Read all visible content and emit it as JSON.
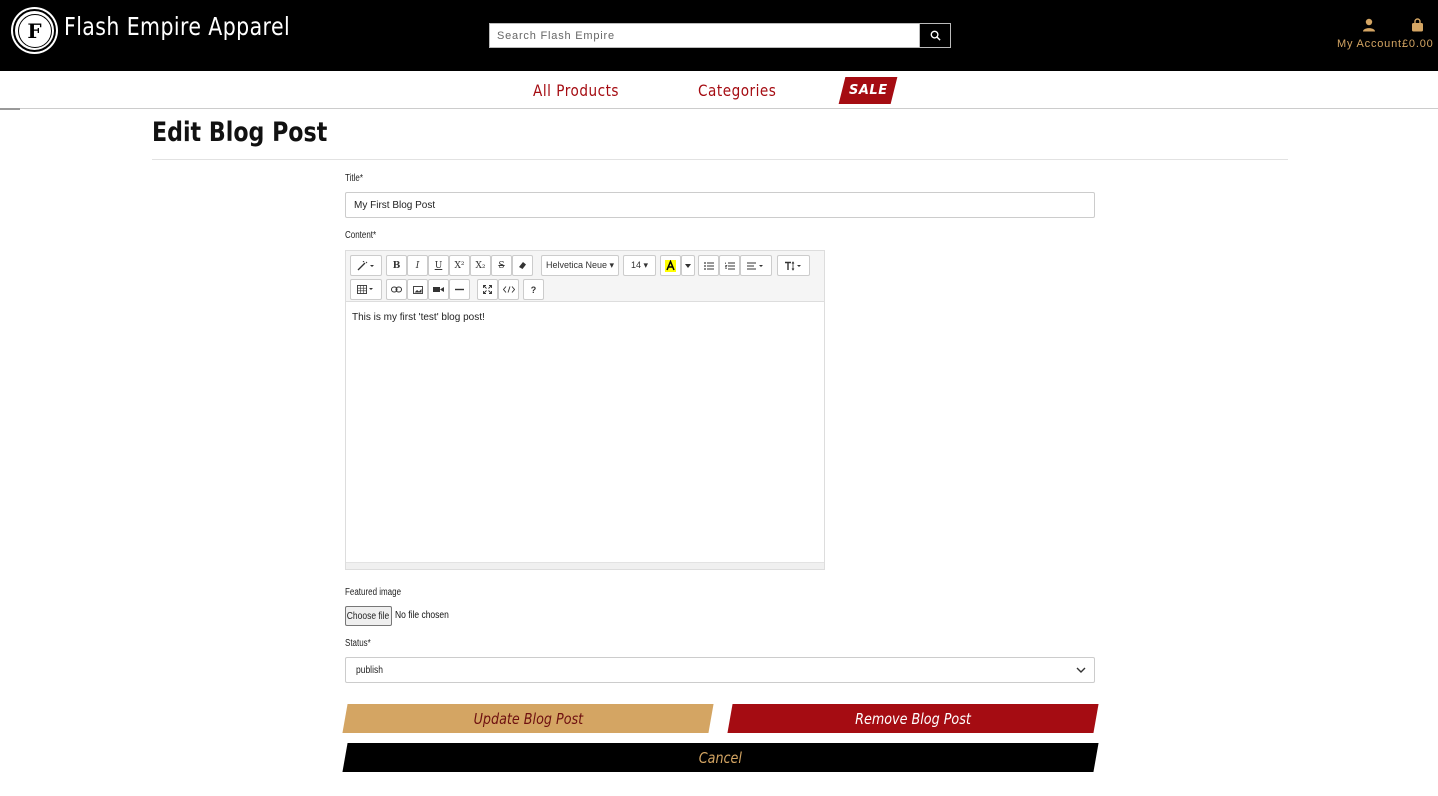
{
  "header": {
    "logo_letter": "F",
    "brand": "Flash Empire Apparel",
    "search_placeholder": "Search Flash Empire",
    "account_label": "My Account",
    "cart_total": "£0.00"
  },
  "nav": {
    "all_products": "All Products",
    "categories": "Categories",
    "sale": "SALE"
  },
  "page": {
    "title": "Edit Blog Post"
  },
  "form": {
    "title_label": "Title*",
    "title_value": "My First Blog Post",
    "content_label": "Content*",
    "toolbar": {
      "font_family": "Helvetica Neue ▾",
      "font_size": "14 ▾",
      "help": "?"
    },
    "content_text": "This is my first 'test' blog post!",
    "featured_image_label": "Featured image",
    "file_button": "Choose file",
    "file_status": "No file chosen",
    "status_label": "Status*",
    "status_value": "publish"
  },
  "buttons": {
    "update": "Update Blog Post",
    "remove": "Remove Blog Post",
    "cancel": "Cancel"
  },
  "colors": {
    "accent_gold": "#d4a563",
    "accent_red": "#a50c12",
    "header_bg": "#000000"
  }
}
